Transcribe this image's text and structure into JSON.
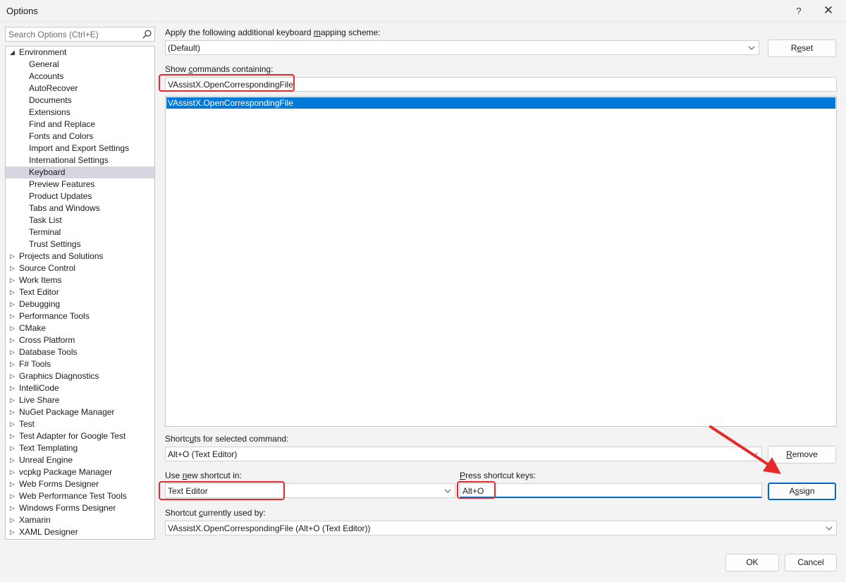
{
  "window": {
    "title": "Options",
    "help_label": "?",
    "close_label": "✕"
  },
  "search": {
    "placeholder": "Search Options (Ctrl+E)"
  },
  "tree": {
    "items": [
      {
        "label": "Environment",
        "level": 0,
        "expanded": true
      },
      {
        "label": "General",
        "level": 1
      },
      {
        "label": "Accounts",
        "level": 1
      },
      {
        "label": "AutoRecover",
        "level": 1
      },
      {
        "label": "Documents",
        "level": 1
      },
      {
        "label": "Extensions",
        "level": 1
      },
      {
        "label": "Find and Replace",
        "level": 1
      },
      {
        "label": "Fonts and Colors",
        "level": 1
      },
      {
        "label": "Import and Export Settings",
        "level": 1
      },
      {
        "label": "International Settings",
        "level": 1
      },
      {
        "label": "Keyboard",
        "level": 1,
        "selected": true
      },
      {
        "label": "Preview Features",
        "level": 1
      },
      {
        "label": "Product Updates",
        "level": 1
      },
      {
        "label": "Tabs and Windows",
        "level": 1
      },
      {
        "label": "Task List",
        "level": 1
      },
      {
        "label": "Terminal",
        "level": 1
      },
      {
        "label": "Trust Settings",
        "level": 1
      },
      {
        "label": "Projects and Solutions",
        "level": 0
      },
      {
        "label": "Source Control",
        "level": 0
      },
      {
        "label": "Work Items",
        "level": 0
      },
      {
        "label": "Text Editor",
        "level": 0
      },
      {
        "label": "Debugging",
        "level": 0
      },
      {
        "label": "Performance Tools",
        "level": 0
      },
      {
        "label": "CMake",
        "level": 0
      },
      {
        "label": "Cross Platform",
        "level": 0
      },
      {
        "label": "Database Tools",
        "level": 0
      },
      {
        "label": "F# Tools",
        "level": 0
      },
      {
        "label": "Graphics Diagnostics",
        "level": 0
      },
      {
        "label": "IntelliCode",
        "level": 0
      },
      {
        "label": "Live Share",
        "level": 0
      },
      {
        "label": "NuGet Package Manager",
        "level": 0
      },
      {
        "label": "Test",
        "level": 0
      },
      {
        "label": "Test Adapter for Google Test",
        "level": 0
      },
      {
        "label": "Text Templating",
        "level": 0
      },
      {
        "label": "Unreal Engine",
        "level": 0
      },
      {
        "label": "vcpkg Package Manager",
        "level": 0
      },
      {
        "label": "Web Forms Designer",
        "level": 0
      },
      {
        "label": "Web Performance Test Tools",
        "level": 0
      },
      {
        "label": "Windows Forms Designer",
        "level": 0
      },
      {
        "label": "Xamarin",
        "level": 0
      },
      {
        "label": "XAML Designer",
        "level": 0
      }
    ]
  },
  "mapping": {
    "label_pre": "Apply the following additional keyboard ",
    "label_ul": "m",
    "label_post": "apping scheme:",
    "value": "(Default)",
    "reset_pre": "R",
    "reset_ul": "e",
    "reset_post": "set"
  },
  "show_commands": {
    "label_pre": "Show ",
    "label_ul": "c",
    "label_post": "ommands containing:",
    "value": "VAssistX.OpenCorrespondingFile",
    "results": [
      "VAssistX.OpenCorrespondingFile"
    ]
  },
  "shortcuts": {
    "label_pre": "Shortc",
    "label_ul": "u",
    "label_post": "ts for selected command:",
    "value": "Alt+O (Text Editor)",
    "remove_pre": "",
    "remove_ul": "R",
    "remove_post": "emove"
  },
  "new_shortcut": {
    "label_pre": "Use ",
    "label_ul": "n",
    "label_post": "ew shortcut in:",
    "value": "Text Editor"
  },
  "press_keys": {
    "label_pre": "",
    "label_ul": "P",
    "label_post": "ress shortcut keys:",
    "value": "Alt+O",
    "assign_pre": "A",
    "assign_ul": "s",
    "assign_post": "sign"
  },
  "used_by": {
    "label_pre": "Shortcut ",
    "label_ul": "c",
    "label_post": "urrently used by:",
    "value": "VAssistX.OpenCorrespondingFile (Alt+O (Text Editor))"
  },
  "footer": {
    "ok_label": "OK",
    "cancel_label": "Cancel"
  },
  "annotation_color": "#e52a2a"
}
